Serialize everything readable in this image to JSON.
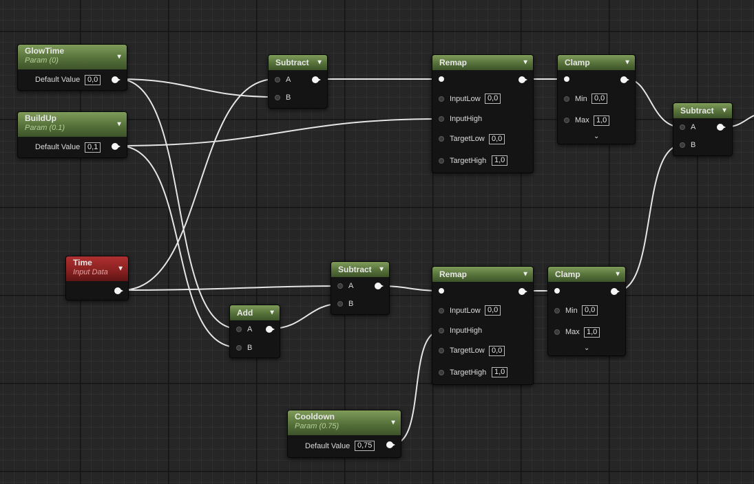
{
  "nodes": {
    "glowtime": {
      "title": "GlowTime",
      "subtitle": "Param (0)",
      "default_label": "Default Value",
      "default_value": "0,0"
    },
    "buildup": {
      "title": "BuildUp",
      "subtitle": "Param (0.1)",
      "default_label": "Default Value",
      "default_value": "0,1"
    },
    "time": {
      "title": "Time",
      "subtitle": "Input Data"
    },
    "cooldown": {
      "title": "Cooldown",
      "subtitle": "Param (0.75)",
      "default_label": "Default Value",
      "default_value": "0,75"
    },
    "subtract_top": {
      "title": "Subtract",
      "pin_a": "A",
      "pin_b": "B"
    },
    "subtract_mid": {
      "title": "Subtract",
      "pin_a": "A",
      "pin_b": "B"
    },
    "subtract_right": {
      "title": "Subtract",
      "pin_a": "A",
      "pin_b": "B"
    },
    "add": {
      "title": "Add",
      "pin_a": "A",
      "pin_b": "B"
    },
    "remap_top": {
      "title": "Remap",
      "input_low_label": "InputLow",
      "input_low": "0,0",
      "input_high_label": "InputHigh",
      "target_low_label": "TargetLow",
      "target_low": "0,0",
      "target_high_label": "TargetHigh",
      "target_high": "1,0"
    },
    "remap_bottom": {
      "title": "Remap",
      "input_low_label": "InputLow",
      "input_low": "0,0",
      "input_high_label": "InputHigh",
      "target_low_label": "TargetLow",
      "target_low": "0,0",
      "target_high_label": "TargetHigh",
      "target_high": "1,0"
    },
    "clamp_top": {
      "title": "Clamp",
      "min_label": "Min",
      "min": "0,0",
      "max_label": "Max",
      "max": "1,0"
    },
    "clamp_bottom": {
      "title": "Clamp",
      "min_label": "Min",
      "min": "0,0",
      "max_label": "Max",
      "max": "1,0"
    }
  },
  "icons": {
    "collapse": "chevron-down-icon",
    "advanced": "chevron-down-icon"
  },
  "colors": {
    "param_header": "#56713a",
    "input_header": "#862020",
    "wire": "#e6e6e6",
    "background": "#262626"
  }
}
